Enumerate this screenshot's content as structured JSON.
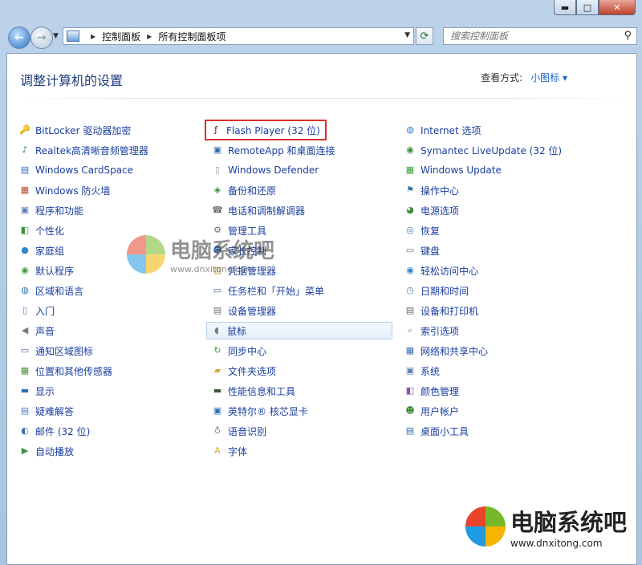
{
  "window": {
    "min_label": "▬",
    "max_label": "□",
    "close_label": "✕"
  },
  "nav": {
    "breadcrumb": [
      "控制面板",
      "所有控制面板项"
    ],
    "search_placeholder": "搜索控制面板"
  },
  "header": {
    "title": "调整计算机的设置",
    "view_label": "查看方式:",
    "view_value": "小图标 ▾"
  },
  "columns": [
    [
      {
        "label": "BitLocker 驱动器加密",
        "icon": "bitlocker-key-icon",
        "color": "#c9a23a",
        "glyph": "🔑"
      },
      {
        "label": "Realtek高清晰音频管理器",
        "icon": "realtek-speaker-icon",
        "color": "#2f7d4f",
        "glyph": "♪"
      },
      {
        "label": "Windows CardSpace",
        "icon": "cardspace-icon",
        "color": "#2e6db3",
        "glyph": "▤"
      },
      {
        "label": "Windows 防火墙",
        "icon": "firewall-icon",
        "color": "#b5492c",
        "glyph": "▦"
      },
      {
        "label": "程序和功能",
        "icon": "programs-icon",
        "color": "#5a7fb0",
        "glyph": "▣"
      },
      {
        "label": "个性化",
        "icon": "personalize-icon",
        "color": "#3a8f3a",
        "glyph": "◧"
      },
      {
        "label": "家庭组",
        "icon": "homegroup-icon",
        "color": "#2e86c9",
        "glyph": "●"
      },
      {
        "label": "默认程序",
        "icon": "default-programs-icon",
        "color": "#3f9c3a",
        "glyph": "◉"
      },
      {
        "label": "区域和语言",
        "icon": "region-globe-icon",
        "color": "#2d73b8",
        "glyph": "◍"
      },
      {
        "label": "入门",
        "icon": "getting-started-icon",
        "color": "#4d88c4",
        "glyph": "▯"
      },
      {
        "label": "声音",
        "icon": "sound-icon",
        "color": "#7a7a7a",
        "glyph": "◀"
      },
      {
        "label": "通知区域图标",
        "icon": "notification-icon",
        "color": "#4f6f99",
        "glyph": "▭"
      },
      {
        "label": "位置和其他传感器",
        "icon": "location-sensor-icon",
        "color": "#4a8c3c",
        "glyph": "▦"
      },
      {
        "label": "显示",
        "icon": "display-icon",
        "color": "#2f6fb3",
        "glyph": "▬"
      },
      {
        "label": "疑难解答",
        "icon": "troubleshoot-icon",
        "color": "#4b7fbf",
        "glyph": "▤"
      },
      {
        "label": "邮件 (32 位)",
        "icon": "mail-icon",
        "color": "#3b6fa8",
        "glyph": "◐"
      },
      {
        "label": "自动播放",
        "icon": "autoplay-icon",
        "color": "#3c8f46",
        "glyph": "▶"
      }
    ],
    [
      {
        "label": "Flash Player (32 位)",
        "icon": "flash-player-icon",
        "color": "#6b0e0e",
        "glyph": "ƒ"
      },
      {
        "label": "RemoteApp 和桌面连接",
        "icon": "remoteapp-icon",
        "color": "#3a6fb0",
        "glyph": "▣"
      },
      {
        "label": "Windows Defender",
        "icon": "defender-icon",
        "color": "#9a9a9a",
        "glyph": "▯"
      },
      {
        "label": "备份和还原",
        "icon": "backup-icon",
        "color": "#3e8c3e",
        "glyph": "◈"
      },
      {
        "label": "电话和调制解调器",
        "icon": "phone-modem-icon",
        "color": "#6a6a6a",
        "glyph": "☎"
      },
      {
        "label": "管理工具",
        "icon": "admin-tools-icon",
        "color": "#6e6e6e",
        "glyph": "⚙"
      },
      {
        "label": "家长控制",
        "icon": "parental-control-icon",
        "color": "#3b7cc0",
        "glyph": "☻"
      },
      {
        "label": "凭据管理器",
        "icon": "credential-icon",
        "color": "#c7a23a",
        "glyph": "▥"
      },
      {
        "label": "任务栏和「开始」菜单",
        "icon": "taskbar-icon",
        "color": "#4f6f99",
        "glyph": "▭"
      },
      {
        "label": "设备管理器",
        "icon": "device-manager-icon",
        "color": "#6f6f6f",
        "glyph": "▤"
      },
      {
        "label": "鼠标",
        "icon": "mouse-icon",
        "color": "#7a7a7a",
        "glyph": "◖"
      },
      {
        "label": "同步中心",
        "icon": "sync-icon",
        "color": "#3e9c3e",
        "glyph": "↻"
      },
      {
        "label": "文件夹选项",
        "icon": "folder-options-icon",
        "color": "#d6ad3c",
        "glyph": "▰"
      },
      {
        "label": "性能信息和工具",
        "icon": "performance-icon",
        "color": "#3a5a3a",
        "glyph": "▬"
      },
      {
        "label": "英特尔® 核芯显卡",
        "icon": "intel-graphics-icon",
        "color": "#2d6fb5",
        "glyph": "▣"
      },
      {
        "label": "语音识别",
        "icon": "speech-icon",
        "color": "#8a8a8a",
        "glyph": "♁"
      },
      {
        "label": "字体",
        "icon": "fonts-icon",
        "color": "#d6ad3c",
        "glyph": "A"
      }
    ],
    [
      {
        "label": "Internet 选项",
        "icon": "internet-options-icon",
        "color": "#2e7fc8",
        "glyph": "◍"
      },
      {
        "label": "Symantec LiveUpdate (32 位)",
        "icon": "liveupdate-icon",
        "color": "#3b8f3b",
        "glyph": "◉"
      },
      {
        "label": "Windows Update",
        "icon": "windows-update-icon",
        "color": "#3a9c3a",
        "glyph": "▦"
      },
      {
        "label": "操作中心",
        "icon": "action-center-icon",
        "color": "#3a6fb0",
        "glyph": "⚑"
      },
      {
        "label": "电源选项",
        "icon": "power-options-icon",
        "color": "#3e8c3e",
        "glyph": "◕"
      },
      {
        "label": "恢复",
        "icon": "recovery-icon",
        "color": "#3a7cc0",
        "glyph": "◎"
      },
      {
        "label": "键盘",
        "icon": "keyboard-icon",
        "color": "#7a7a7a",
        "glyph": "▭"
      },
      {
        "label": "轻松访问中心",
        "icon": "ease-of-access-icon",
        "color": "#2e7fc8",
        "glyph": "◉"
      },
      {
        "label": "日期和时间",
        "icon": "datetime-icon",
        "color": "#5a7fb0",
        "glyph": "◷"
      },
      {
        "label": "设备和打印机",
        "icon": "printer-icon",
        "color": "#6a6a6a",
        "glyph": "▤"
      },
      {
        "label": "索引选项",
        "icon": "indexing-icon",
        "color": "#8a8a8a",
        "glyph": "⌕"
      },
      {
        "label": "网络和共享中心",
        "icon": "network-icon",
        "color": "#3b6fa8",
        "glyph": "▦"
      },
      {
        "label": "系统",
        "icon": "system-icon",
        "color": "#5a7fb0",
        "glyph": "▣"
      },
      {
        "label": "颜色管理",
        "icon": "color-management-icon",
        "color": "#8a4fb0",
        "glyph": "◧"
      },
      {
        "label": "用户帐户",
        "icon": "user-accounts-icon",
        "color": "#3e8c3e",
        "glyph": "☻"
      },
      {
        "label": "桌面小工具",
        "icon": "gadgets-icon",
        "color": "#2e6db3",
        "glyph": "▤"
      }
    ]
  ],
  "watermark": {
    "text_cn": "电脑系统吧",
    "text_url": "www.dnxitong.com"
  }
}
